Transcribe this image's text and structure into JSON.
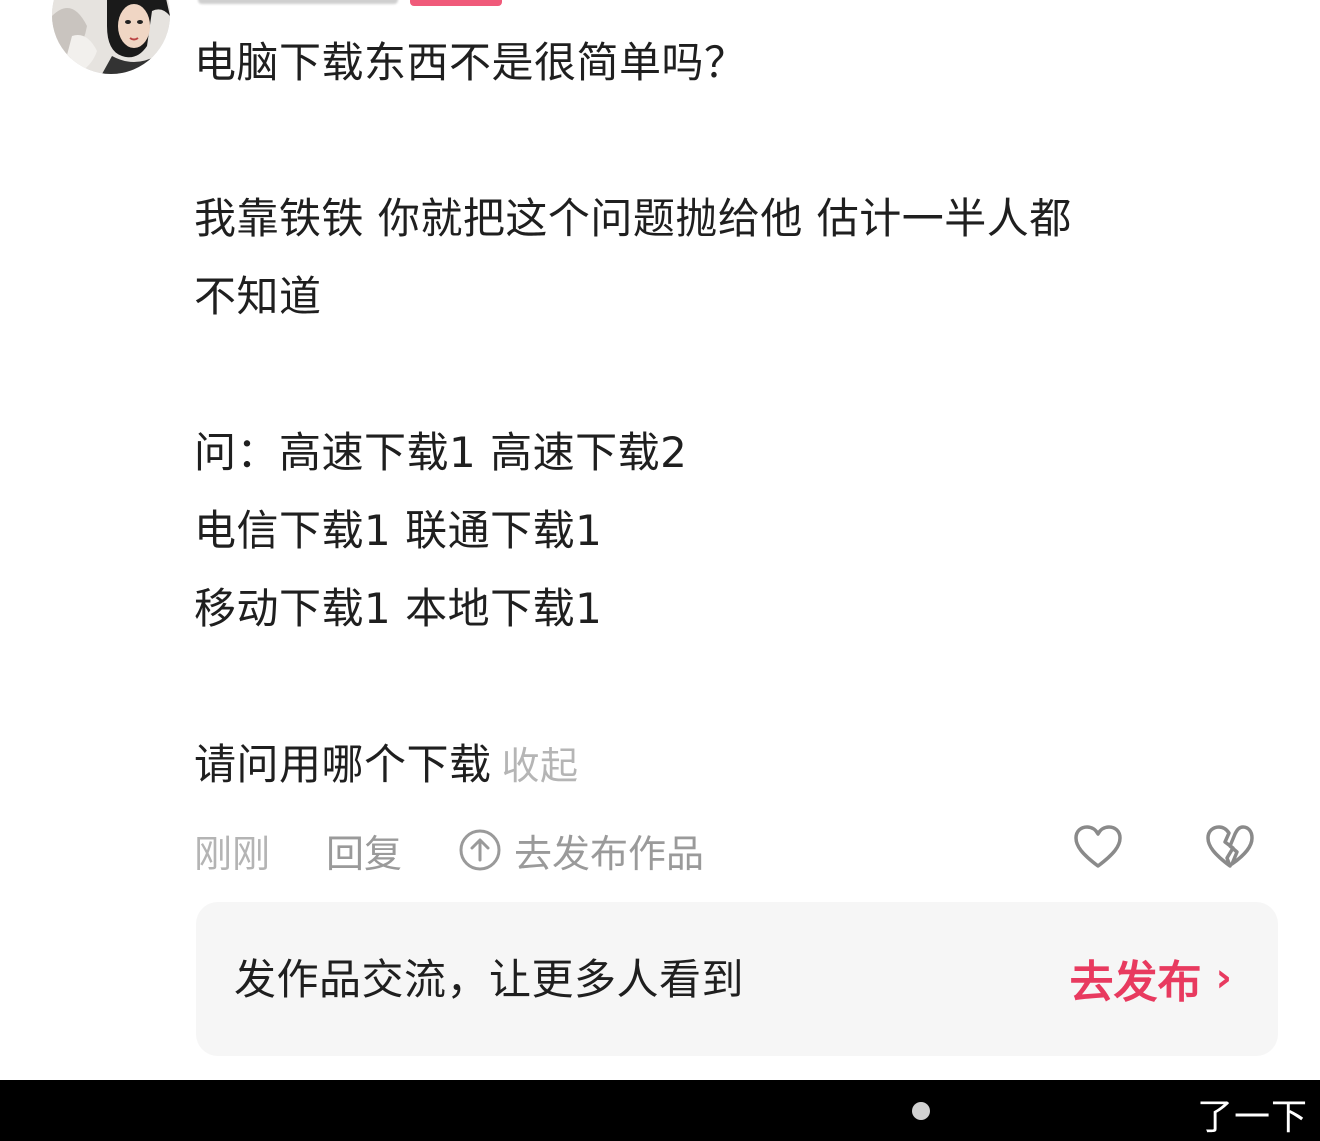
{
  "comment": {
    "lines": {
      "l1": "电脑下载东西不是很简单吗？",
      "l2": "我靠铁铁  你就把这个问题抛给他 估计一半人都",
      "l3": "不知道",
      "l4": "问：高速下载1 高速下载2",
      "l5": "电信下载1 联通下载1",
      "l6": "移动下载1 本地下载1",
      "l7": "请问用哪个下载"
    },
    "collapse_label": "收起"
  },
  "meta": {
    "time": "刚刚",
    "reply_label": "回复",
    "publish_label": "去发布作品"
  },
  "promo": {
    "text": "发作品交流，让更多人看到",
    "button_label": "去发布",
    "button_chevron": "›",
    "accent_color": "#e83a5f"
  },
  "bottom_bar": {
    "text": "了一下"
  }
}
